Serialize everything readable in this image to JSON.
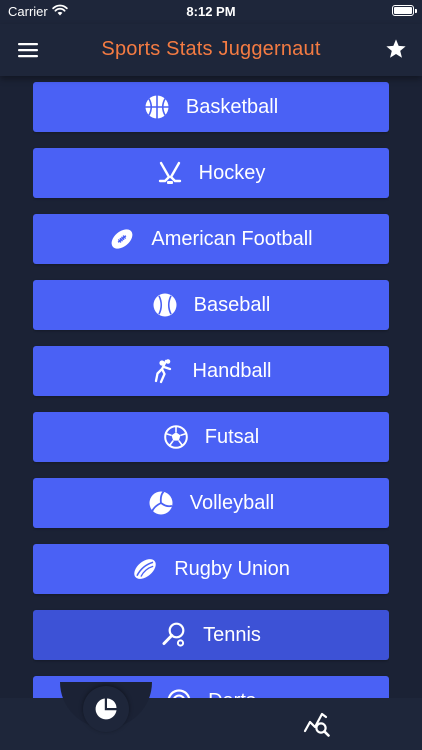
{
  "status_bar": {
    "carrier": "Carrier",
    "time": "8:12 PM",
    "wifi_icon": "wifi-icon",
    "battery_icon": "battery-icon"
  },
  "header": {
    "title": "Sports Stats Juggernaut",
    "title_color": "#f47b42",
    "menu_icon": "hamburger-menu-icon",
    "favorites_icon": "star-icon"
  },
  "sports": [
    {
      "label": "Basketball",
      "icon": "basketball-icon"
    },
    {
      "label": "Hockey",
      "icon": "hockey-icon"
    },
    {
      "label": "American Football",
      "icon": "american-football-icon"
    },
    {
      "label": "Baseball",
      "icon": "baseball-icon"
    },
    {
      "label": "Handball",
      "icon": "handball-icon"
    },
    {
      "label": "Futsal",
      "icon": "futsal-ball-icon"
    },
    {
      "label": "Volleyball",
      "icon": "volleyball-icon"
    },
    {
      "label": "Rugby Union",
      "icon": "rugby-ball-icon"
    },
    {
      "label": "Tennis",
      "icon": "tennis-racket-icon"
    },
    {
      "label": "Darts",
      "icon": "darts-icon"
    }
  ],
  "tab_bar": {
    "center_tab_icon": "pie-chart-icon",
    "right_tab_icon": "chart-search-icon"
  },
  "colors": {
    "background": "#1b2235",
    "bar": "#1e263a",
    "button": "#4a61f5",
    "button_pressed": "#3d52d6",
    "accent": "#f47b42"
  }
}
